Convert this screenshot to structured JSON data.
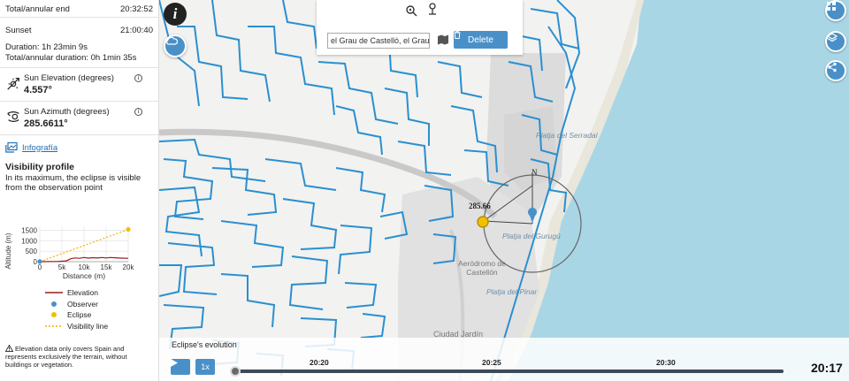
{
  "panel": {
    "total_annular_end": {
      "label": "Total/annular end",
      "value": "20:32:52"
    },
    "sunset": {
      "label": "Sunset",
      "value": "21:00:40"
    },
    "duration": "Duration: 1h 23min 9s",
    "total_duration": "Total/annular duration: 0h 1min 35s",
    "sun_elevation": {
      "label": "Sun Elevation (degrees)",
      "value": "4.557°",
      "info": "i"
    },
    "sun_azimuth": {
      "label": "Sun Azimuth (degrees)",
      "value": "285.6611°",
      "info": "i"
    },
    "infografia": "Infografía",
    "visibility": {
      "title": "Visibility profile",
      "desc": "In its maximum, the eclipse is visible from the observation point"
    },
    "legend": [
      "Elevation",
      "Observer",
      "Eclipse",
      "Visibility line"
    ],
    "warning": "Elevation data only covers Spain and represents exclusively the terrain, without buildings or vegetation."
  },
  "chart_data": {
    "type": "line",
    "xlabel": "Distance (m)",
    "ylabel": "Altitude (m)",
    "x_ticks": [
      "0",
      "5k",
      "10k",
      "15k",
      "20k"
    ],
    "y_ticks": [
      "0",
      "500",
      "1000",
      "1500"
    ],
    "xlim": [
      0,
      20000
    ],
    "ylim": [
      0,
      1700
    ],
    "series": [
      {
        "name": "Elevation",
        "color": "#9b1c1c",
        "x": [
          0,
          2000,
          4000,
          6000,
          7000,
          8000,
          9000,
          10000,
          11000,
          12000,
          13000,
          14000,
          15000,
          16000,
          17000,
          18000,
          19000,
          20000
        ],
        "y": [
          0,
          5,
          10,
          40,
          140,
          180,
          160,
          200,
          170,
          190,
          175,
          200,
          180,
          200,
          185,
          175,
          165,
          160
        ]
      },
      {
        "name": "Visibility line",
        "color": "#f0b400",
        "x": [
          0,
          20000
        ],
        "y": [
          0,
          1550
        ]
      }
    ],
    "points": [
      {
        "name": "Observer",
        "x": 0,
        "y": 5,
        "color": "#4a90c8"
      },
      {
        "name": "Eclipse",
        "x": 20000,
        "y": 1550,
        "color": "#f0c000"
      }
    ]
  },
  "map": {
    "labels": {
      "serradal": "Platja del Serradal",
      "gurugu": "Platja del Gurugú",
      "aerodromo": "Aeródromo de\nCastellón",
      "pinar": "Platja del Pinar",
      "ciudad": "Ciudad Jardín",
      "azimuth": "285.66",
      "north": "N"
    },
    "address": "el Grau de Castelló, el Grau",
    "delete_label": "Delete",
    "info_letter": "i",
    "colors": {
      "streets": "#2a8fd0",
      "water": "#a9d6e5",
      "accent": "#4a90c8"
    }
  },
  "timeline": {
    "title": "Eclipse's evolution",
    "speed": "1x",
    "ticks": [
      "20:20",
      "20:25",
      "20:30"
    ],
    "current": "20:17",
    "progress": 0.0
  }
}
